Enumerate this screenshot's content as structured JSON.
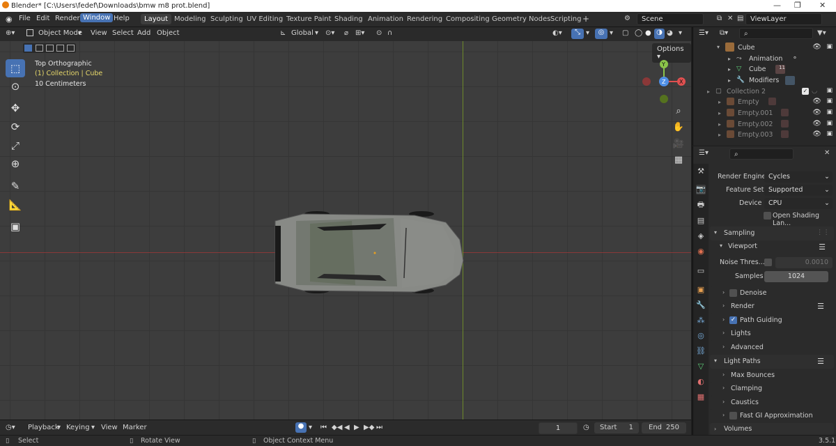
{
  "window": {
    "title": "Blender* [C:\\Users\\fedef\\Downloads\\bmw m8 prot.blend]",
    "minimize": "—",
    "maximize": "❐",
    "close": "✕"
  },
  "menu": [
    "File",
    "Edit",
    "Render",
    "Window",
    "Help"
  ],
  "workspaces": [
    "Layout",
    "Modeling",
    "Sculpting",
    "UV Editing",
    "Texture Paint",
    "Shading",
    "Animation",
    "Rendering",
    "Compositing",
    "Geometry Nodes",
    "Scripting"
  ],
  "scene": "Scene",
  "view_layer": "ViewLayer",
  "viewport_header": {
    "mode": "Object Mode",
    "view": "View",
    "select": "Select",
    "add": "Add",
    "object": "Object",
    "orientation": "Global",
    "options": "Options"
  },
  "overlay_text": {
    "view_name": "Top Orthographic",
    "collection": "(1) Collection | Cube",
    "scale": "10 Centimeters"
  },
  "gizmo": {
    "x": "X",
    "y": "Y",
    "z": "Z"
  },
  "outliner": {
    "rows": [
      {
        "label": "Cube",
        "muted": false
      },
      {
        "label": "Animation",
        "muted": false
      },
      {
        "label": "Cube",
        "muted": false
      },
      {
        "label": "Modifiers",
        "muted": false
      },
      {
        "label": "Collection 2",
        "muted": true
      },
      {
        "label": "Empty",
        "muted": true
      },
      {
        "label": "Empty.001",
        "muted": true
      },
      {
        "label": "Empty.002",
        "muted": true
      },
      {
        "label": "Empty.003",
        "muted": true
      }
    ],
    "badge": "11"
  },
  "properties": {
    "render_engine_label": "Render Engine",
    "render_engine": "Cycles",
    "feature_set_label": "Feature Set",
    "feature_set": "Supported",
    "device_label": "Device",
    "device": "CPU",
    "osl": "Open Shading Lan...",
    "sampling": "Sampling",
    "viewport": "Viewport",
    "noise_label": "Noise Thres...",
    "noise_value": "0.0010",
    "samples_label": "Samples",
    "samples_value": "1024",
    "denoise": "Denoise",
    "render": "Render",
    "path_guiding": "Path Guiding",
    "lights": "Lights",
    "advanced": "Advanced",
    "light_paths": "Light Paths",
    "max_bounces": "Max Bounces",
    "clamping": "Clamping",
    "caustics": "Caustics",
    "fast_gi": "Fast GI Approximation",
    "volumes": "Volumes"
  },
  "timeline": {
    "playback": "Playback",
    "keying": "Keying",
    "view": "View",
    "marker": "Marker",
    "current_frame": "1",
    "start_label": "Start",
    "start": "1",
    "end_label": "End",
    "end": "250"
  },
  "status": {
    "select": "Select",
    "rotate": "Rotate View",
    "context": "Object Context Menu",
    "version": "3.5.1"
  }
}
